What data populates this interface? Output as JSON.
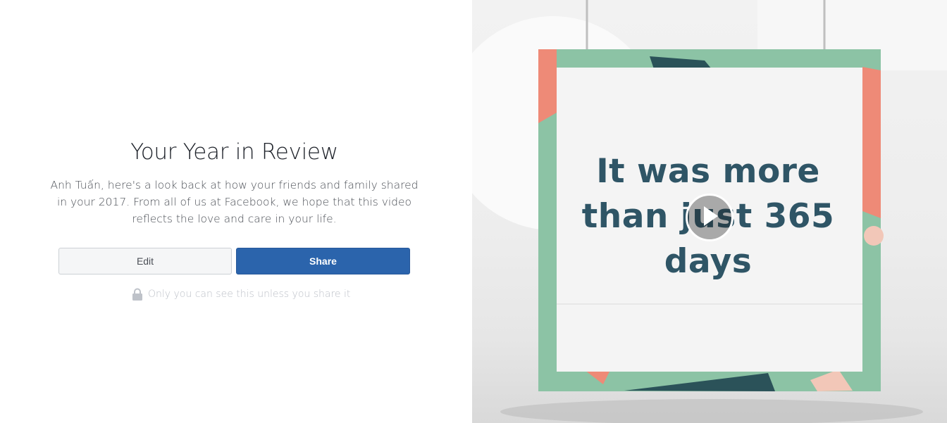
{
  "review": {
    "title": "Your Year in Review",
    "description": "Anh Tuấn, here's a look back at how your friends and family shared in your 2017. From all of us at Facebook, we hope that this video reflects the love and care in your life."
  },
  "actions": {
    "edit_label": "Edit",
    "share_label": "Share"
  },
  "privacy": {
    "icon": "lock-icon",
    "text": "Only you can see this unless you share it"
  },
  "video": {
    "card_text": "It was more than just 365 days",
    "play_icon": "play-icon"
  },
  "colors": {
    "share_button": "#2b64ac",
    "card_border": "#8cc3a5",
    "card_text": "#2f5566",
    "accent_coral": "#ee8a77"
  }
}
